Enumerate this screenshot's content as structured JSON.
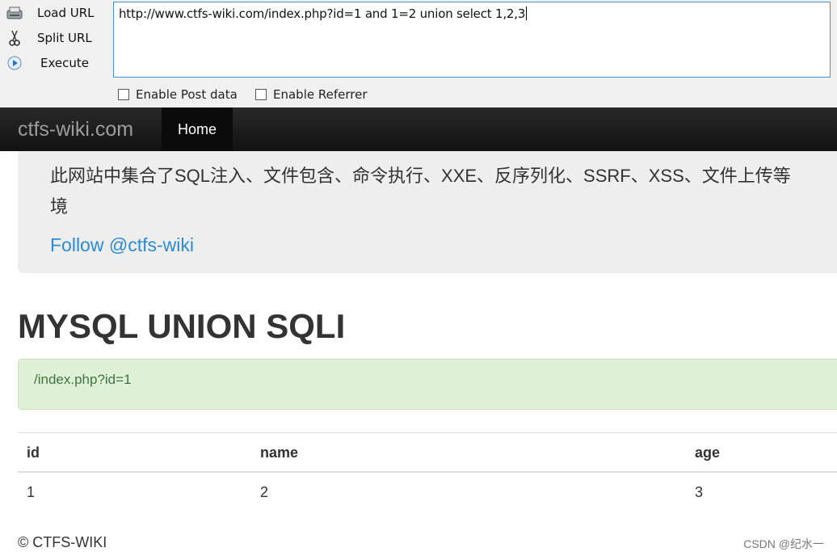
{
  "hackbar": {
    "load_url": "Load URL",
    "split_url": "Split URL",
    "execute": "Execute",
    "url": "http://www.ctfs-wiki.com/index.php?id=1 and 1=2 union select 1,2,3",
    "enable_post": "Enable Post data",
    "enable_referrer": "Enable Referrer"
  },
  "navbar": {
    "brand": "ctfs-wiki.com",
    "home": "Home"
  },
  "jumbotron": {
    "line1": "此网站中集合了SQL注入、文件包含、命令执行、XXE、反序列化、SSRF、XSS、文件上传等",
    "line2": "境",
    "follow": "Follow @ctfs-wiki"
  },
  "page": {
    "title": "MYSQL UNION SQLI",
    "alert": "/index.php?id=1"
  },
  "table": {
    "headers": [
      "id",
      "name",
      "age"
    ],
    "rows": [
      [
        "1",
        "2",
        "3"
      ]
    ]
  },
  "footer": {
    "copyright": "© CTFS-WIKI",
    "watermark": "CSDN @纪水一"
  }
}
